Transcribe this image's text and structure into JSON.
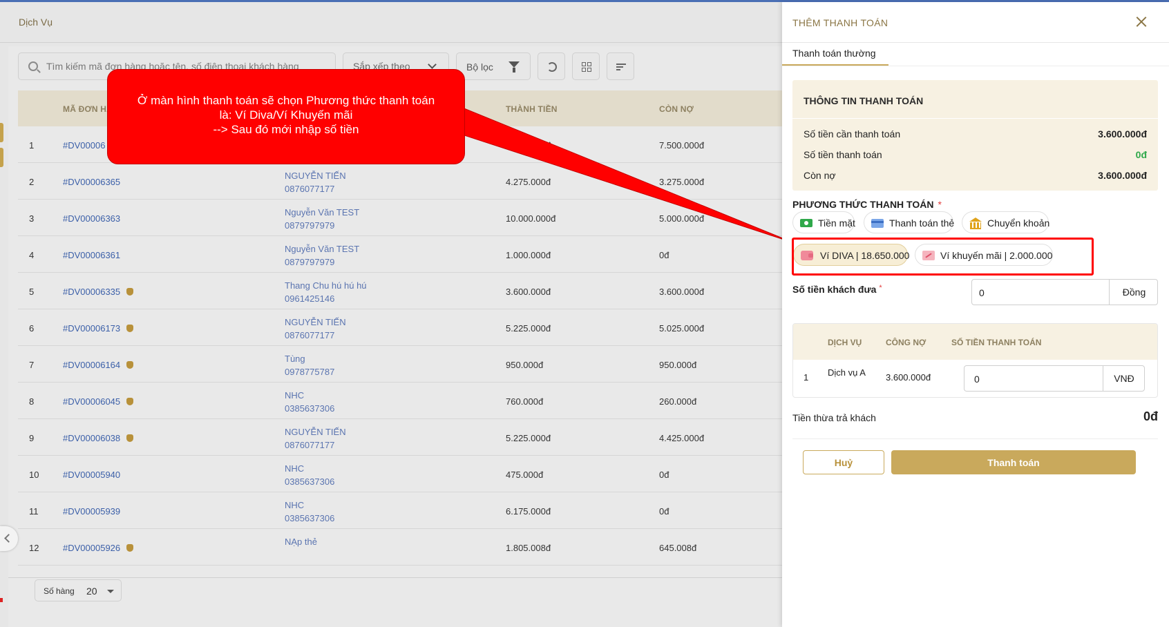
{
  "page": {
    "title": "Dịch Vụ",
    "search_placeholder": "Tìm kiếm mã đơn hàng hoặc tên, số điện thoại khách hàng",
    "sort_label": "Sắp xếp theo",
    "filter_label": "Bộ lọc"
  },
  "table": {
    "columns": [
      "MÃ ĐƠN HÀNG",
      "THÀNH TIỀN",
      "CÒN NỢ"
    ],
    "rows": [
      {
        "no": "1",
        "code": "#DV00006",
        "name": "",
        "phone": "",
        "total": "7.500.000đ",
        "debt": "7.500.000đ",
        "bag": false
      },
      {
        "no": "2",
        "code": "#DV00006365",
        "name": "NGUYỄN TIẾN",
        "phone": "0876077177",
        "total": "4.275.000đ",
        "debt": "3.275.000đ",
        "bag": false
      },
      {
        "no": "3",
        "code": "#DV00006363",
        "name": "Nguyễn Văn TEST",
        "phone": "0879797979",
        "total": "10.000.000đ",
        "debt": "5.000.000đ",
        "bag": false
      },
      {
        "no": "4",
        "code": "#DV00006361",
        "name": "Nguyễn Văn TEST",
        "phone": "0879797979",
        "total": "1.000.000đ",
        "debt": "0đ",
        "bag": false
      },
      {
        "no": "5",
        "code": "#DV00006335",
        "name": "Thang Chu hú hú hú",
        "phone": "0961425146",
        "total": "3.600.000đ",
        "debt": "3.600.000đ",
        "bag": true
      },
      {
        "no": "6",
        "code": "#DV00006173",
        "name": "NGUYỄN TIẾN",
        "phone": "0876077177",
        "total": "5.225.000đ",
        "debt": "5.025.000đ",
        "bag": true
      },
      {
        "no": "7",
        "code": "#DV00006164",
        "name": "Tùng",
        "phone": "0978775787",
        "total": "950.000đ",
        "debt": "950.000đ",
        "bag": true
      },
      {
        "no": "8",
        "code": "#DV00006045",
        "name": "NHC",
        "phone": "0385637306",
        "total": "760.000đ",
        "debt": "260.000đ",
        "bag": true
      },
      {
        "no": "9",
        "code": "#DV00006038",
        "name": "NGUYỄN TIẾN",
        "phone": "0876077177",
        "total": "5.225.000đ",
        "debt": "4.425.000đ",
        "bag": true
      },
      {
        "no": "10",
        "code": "#DV00005940",
        "name": "NHC",
        "phone": "0385637306",
        "total": "475.000đ",
        "debt": "0đ",
        "bag": false
      },
      {
        "no": "11",
        "code": "#DV00005939",
        "name": "NHC",
        "phone": "0385637306",
        "total": "6.175.000đ",
        "debt": "0đ",
        "bag": false
      },
      {
        "no": "12",
        "code": "#DV00005926",
        "name": "NẠp thẻ",
        "phone": "",
        "total": "1.805.008đ",
        "debt": "645.008đ",
        "bag": true
      }
    ]
  },
  "pager": {
    "label": "Số hàng",
    "value": "20"
  },
  "callout": {
    "line1": "Ở màn hình thanh toán sẽ chọn Phương thức thanh toán",
    "line2": "là: Ví Diva/Ví Khuyến mãi",
    "line3": "--> Sau đó mới nhập số tiền"
  },
  "drawer": {
    "title": "THÊM THANH TOÁN",
    "tab": "Thanh toán thường",
    "info": {
      "title": "THÔNG TIN THANH TOÁN",
      "need_label": "Số tiền cần thanh toán",
      "need_value": "3.600.000đ",
      "paid_label": "Số tiền thanh toán",
      "paid_value": "0đ",
      "debt_label": "Còn nợ",
      "debt_value": "3.600.000đ"
    },
    "method_label": "PHƯƠNG THỨC THANH TOÁN",
    "required_mark": "*",
    "methods": {
      "cash": "Tiền mặt",
      "card": "Thanh toán thẻ",
      "transfer": "Chuyển khoản",
      "diva": "Ví DIVA | 18.650.000",
      "promo": "Ví khuyến mãi | 2.000.000"
    },
    "amount_label": "Số tiền khách đưa",
    "amount_value": "0",
    "amount_unit": "Đồng",
    "service_table": {
      "headers": [
        "DỊCH VỤ",
        "CÔNG NỢ",
        "SỐ TIỀN THANH TOÁN"
      ],
      "row": {
        "no": "1",
        "service": "Dịch vụ A",
        "debt": "3.600.000đ",
        "pay": "0",
        "unit": "VNĐ"
      }
    },
    "change_label": "Tiền thừa trả khách",
    "change_value": "0đ",
    "cancel_label": "Huỷ",
    "pay_label": "Thanh toán"
  },
  "colors": {
    "accent": "#c9a95c",
    "highlight": "#ff0000",
    "link": "#3b5fa8"
  }
}
